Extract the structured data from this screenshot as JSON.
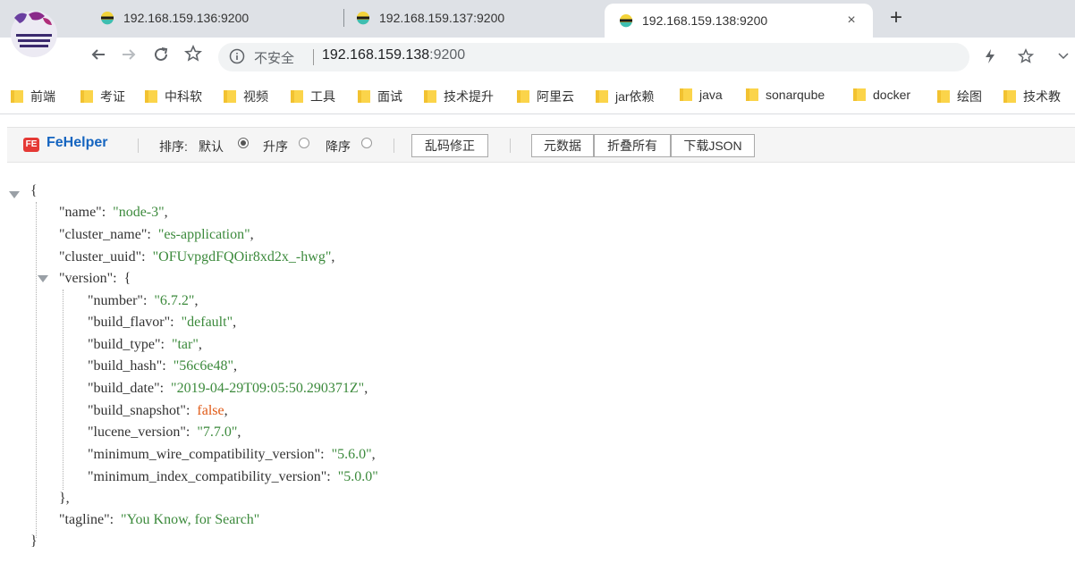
{
  "browser": {
    "tabs": [
      {
        "title": "192.168.159.136:9200",
        "active": false
      },
      {
        "title": "192.168.159.137:9200",
        "active": false
      },
      {
        "title": "192.168.159.138:9200",
        "active": true
      }
    ],
    "new_tab_symbol": "+",
    "close_symbol": "×"
  },
  "toolbar": {
    "insecure_label": "不安全",
    "url_host": "192.168.159.138",
    "url_port": ":9200"
  },
  "bookmarks": [
    "前端",
    "考证",
    "中科软",
    "视频",
    "工具",
    "面试",
    "技术提升",
    "阿里云",
    "jar依赖",
    "java",
    "sonarqube",
    "docker",
    "绘图",
    "技术教"
  ],
  "fehelper": {
    "logo": "FE",
    "name": "FeHelper",
    "sort_label": "排序:",
    "sort_default": "默认",
    "sort_asc": "升序",
    "sort_desc": "降序",
    "sort_selected": "默认",
    "fix_encoding": "乱码修正",
    "metadata": "元数据",
    "collapse_all": "折叠所有",
    "download_json": "下载JSON"
  },
  "json": {
    "name": "\"node-3\"",
    "cluster_name": "\"es-application\"",
    "cluster_uuid": "\"OFUvpgdFQOir8xd2x_-hwg\"",
    "version": {
      "number": "\"6.7.2\"",
      "build_flavor": "\"default\"",
      "build_type": "\"tar\"",
      "build_hash": "\"56c6e48\"",
      "build_date": "\"2019-04-29T09:05:50.290371Z\"",
      "build_snapshot": "false",
      "lucene_version": "\"7.7.0\"",
      "minimum_wire_compatibility_version": "\"5.6.0\"",
      "minimum_index_compatibility_version": "\"5.0.0\""
    },
    "tagline": "\"You Know, for Search\""
  },
  "colors": {
    "json_string": "#3c8a3c",
    "json_boolean": "#e05a16",
    "fehelper_blue": "#1565c0"
  }
}
